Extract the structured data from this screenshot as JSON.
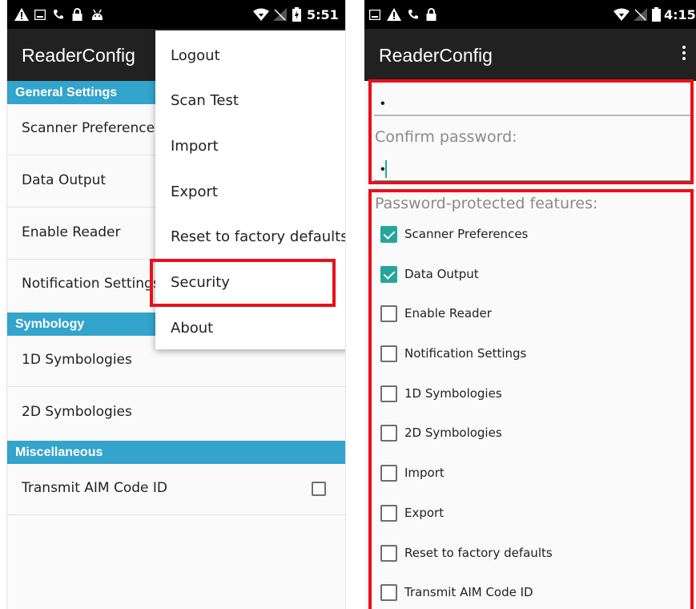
{
  "left": {
    "status": {
      "time": "5:51"
    },
    "app_title": "ReaderConfig",
    "sections": [
      {
        "header": "General Settings",
        "items": [
          "Scanner Preferences",
          "Data Output",
          "Enable Reader",
          "Notification Settings"
        ]
      },
      {
        "header": "Symbology",
        "items": [
          "1D Symbologies",
          "2D Symbologies"
        ]
      },
      {
        "header": "Miscellaneous",
        "items": [
          "Transmit AIM Code ID"
        ]
      }
    ],
    "transmit_aim_checked": false,
    "overflow_menu": [
      "Logout",
      "Scan Test",
      "Import",
      "Export",
      "Reset to factory defaults",
      "Security",
      "About"
    ],
    "highlighted_menu_item": "Security"
  },
  "right": {
    "status": {
      "time": "4:15"
    },
    "app_title": "ReaderConfig",
    "password_value": "•",
    "confirm_label": "Confirm password:",
    "confirm_value": "•",
    "features_label": "Password-protected features:",
    "features": [
      {
        "label": "Scanner Preferences",
        "checked": true
      },
      {
        "label": "Data Output",
        "checked": true
      },
      {
        "label": "Enable Reader",
        "checked": false
      },
      {
        "label": "Notification Settings",
        "checked": false
      },
      {
        "label": "1D Symbologies",
        "checked": false
      },
      {
        "label": "2D Symbologies",
        "checked": false
      },
      {
        "label": "Import",
        "checked": false
      },
      {
        "label": "Export",
        "checked": false
      },
      {
        "label": "Reset to factory defaults",
        "checked": false
      },
      {
        "label": "Transmit AIM Code ID",
        "checked": false
      }
    ]
  },
  "colors": {
    "section_header": "#33a4cc",
    "app_bar": "#212121",
    "accent": "#26a69a",
    "highlight": "#e8101a"
  },
  "icons": [
    "warning-icon",
    "image-icon",
    "phone-icon",
    "lock-icon",
    "android-icon",
    "wifi-icon",
    "no-signal-icon",
    "battery-icon",
    "more-vert-icon"
  ]
}
